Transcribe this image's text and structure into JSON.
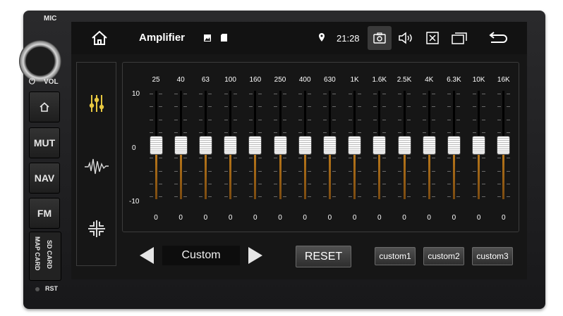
{
  "bezel": {
    "mic_label": "MIC",
    "vol_label": "VOL",
    "power_icon": "power-icon",
    "buttons": [
      {
        "icon": "home-icon",
        "label": ""
      },
      {
        "label": "MUT"
      },
      {
        "label": "NAV"
      },
      {
        "label": "FM"
      }
    ],
    "map_card_label": "MAP CARD",
    "sd_card_label": "SD CARD",
    "reset_label": "RST"
  },
  "statusbar": {
    "title": "Amplifier",
    "time": "21:28",
    "icons": [
      "home-icon",
      "image-icon",
      "sd-card-icon",
      "location-pin-icon",
      "screenshot-icon",
      "volume-icon",
      "close-box-icon",
      "recent-apps-icon",
      "back-icon"
    ]
  },
  "tabs": [
    {
      "icon": "equalizer-sliders-icon",
      "active": true
    },
    {
      "icon": "waveform-icon",
      "active": false
    },
    {
      "icon": "balance-fader-icon",
      "active": false
    }
  ],
  "equalizer": {
    "scale_labels": [
      "10",
      "0",
      "-10"
    ],
    "range": [
      -10,
      10
    ],
    "bands": [
      {
        "label": "25",
        "value": 0
      },
      {
        "label": "40",
        "value": 0
      },
      {
        "label": "63",
        "value": 0
      },
      {
        "label": "100",
        "value": 0
      },
      {
        "label": "160",
        "value": 0
      },
      {
        "label": "250",
        "value": 0
      },
      {
        "label": "400",
        "value": 0
      },
      {
        "label": "630",
        "value": 0
      },
      {
        "label": "1K",
        "value": 0
      },
      {
        "label": "1.6K",
        "value": 0
      },
      {
        "label": "2.5K",
        "value": 0
      },
      {
        "label": "4K",
        "value": 0
      },
      {
        "label": "6.3K",
        "value": 0
      },
      {
        "label": "10K",
        "value": 0
      },
      {
        "label": "16K",
        "value": 0
      }
    ]
  },
  "presets": {
    "current": "Custom",
    "reset_label": "RESET",
    "custom_buttons": [
      "custom1",
      "custom2",
      "custom3"
    ]
  },
  "colors": {
    "accent": "#c8821c",
    "active_tab": "#e8c840"
  }
}
